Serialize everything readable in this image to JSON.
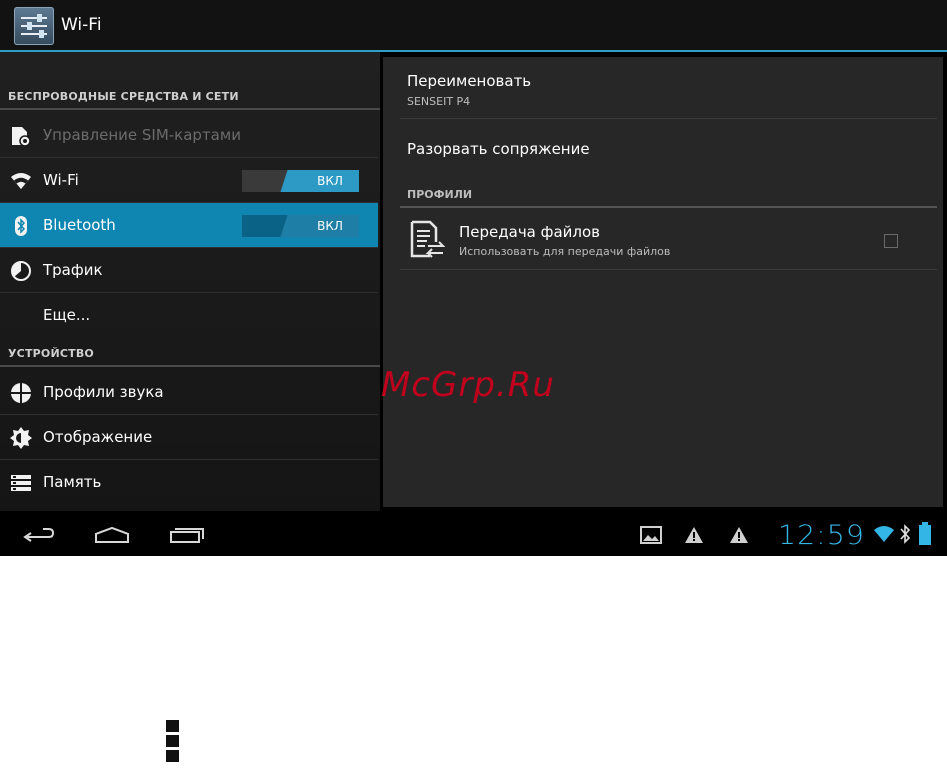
{
  "action_bar": {
    "title": "Wi-Fi",
    "app_icon": "settings-sliders-icon"
  },
  "left_panel": {
    "section_wireless": "БЕСПРОВОДНЫЕ СРЕДСТВА И СЕТИ",
    "section_device": "УСТРОЙСТВО",
    "items": [
      {
        "label": "Управление SIM-картами",
        "icon": "sim-settings-icon",
        "enabled": false
      },
      {
        "label": "Wi-Fi",
        "icon": "wifi-icon",
        "toggle": "ВКЛ"
      },
      {
        "label": "Bluetooth",
        "icon": "bluetooth-icon",
        "toggle": "ВКЛ",
        "selected": true
      },
      {
        "label": "Трафик",
        "icon": "data-usage-icon"
      },
      {
        "label": "Еще..."
      },
      {
        "label": "Профили звука",
        "icon": "sound-profile-icon"
      },
      {
        "label": "Отображение",
        "icon": "display-brightness-icon"
      },
      {
        "label": "Память",
        "icon": "storage-icon"
      }
    ]
  },
  "right_panel": {
    "rename_title": "Переименовать",
    "device_name": "SENSEIT P4",
    "unpair": "Разорвать сопряжение",
    "profiles_header": "ПРОФИЛИ",
    "profile": {
      "title": "Передача файлов",
      "subtitle": "Использовать для передачи файлов",
      "icon": "file-transfer-icon",
      "checked": false
    }
  },
  "watermark": "McGrp.Ru",
  "nav_bar": {
    "buttons": [
      "back-icon",
      "home-icon",
      "recent-apps-icon"
    ],
    "status_icons": [
      "gallery-notification-icon",
      "warning-icon",
      "warning-icon",
      "wifi-signal-icon",
      "bluetooth-status-icon",
      "battery-icon"
    ],
    "clock": "12:59"
  },
  "colors": {
    "accent": "#33b5e5",
    "selected_row": "#0f86b1",
    "watermark": "#c0001c"
  }
}
